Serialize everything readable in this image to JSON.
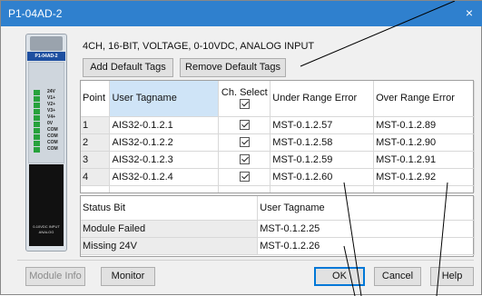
{
  "window": {
    "title": "P1-04AD-2",
    "close_glyph": "×"
  },
  "module": {
    "label": "P1-04AD-2",
    "channels": [
      "24V",
      "V1+",
      "V2+",
      "V3+",
      "V4+",
      "0V",
      "COM",
      "COM",
      "COM",
      "COM"
    ],
    "footer_line1": "0-10VDC INPUT",
    "footer_line2": "ANALOG"
  },
  "description": "4CH, 16-BIT, VOLTAGE, 0-10VDC, ANALOG INPUT",
  "toolbar": {
    "add_default_tags": "Add Default Tags",
    "remove_default_tags": "Remove Default Tags"
  },
  "points_grid": {
    "headers": {
      "point": "Point",
      "user_tagname": "User Tagname",
      "ch_select": "Ch. Select",
      "under_range": "Under Range Error",
      "over_range": "Over Range Error"
    },
    "rows": [
      {
        "point": "1",
        "tagname": "AIS32-0.1.2.1",
        "selected": true,
        "under": "MST-0.1.2.57",
        "over": "MST-0.1.2.89"
      },
      {
        "point": "2",
        "tagname": "AIS32-0.1.2.2",
        "selected": true,
        "under": "MST-0.1.2.58",
        "over": "MST-0.1.2.90"
      },
      {
        "point": "3",
        "tagname": "AIS32-0.1.2.3",
        "selected": true,
        "under": "MST-0.1.2.59",
        "over": "MST-0.1.2.91"
      },
      {
        "point": "4",
        "tagname": "AIS32-0.1.2.4",
        "selected": true,
        "under": "MST-0.1.2.60",
        "over": "MST-0.1.2.92"
      }
    ]
  },
  "status_grid": {
    "headers": {
      "status_bit": "Status Bit",
      "user_tagname": "User Tagname"
    },
    "rows": [
      {
        "status_bit": "Module Failed",
        "tagname": "MST-0.1.2.25"
      },
      {
        "status_bit": "Missing 24V",
        "tagname": "MST-0.1.2.26"
      }
    ]
  },
  "footer_buttons": {
    "module_info": "Module Info",
    "monitor": "Monitor",
    "ok": "OK",
    "cancel": "Cancel",
    "help": "Help"
  },
  "colors": {
    "titlebar": "#2f80ce",
    "selection": "#cfe4f7",
    "module_label": "#1e4fa0",
    "led": "#27a23c"
  }
}
